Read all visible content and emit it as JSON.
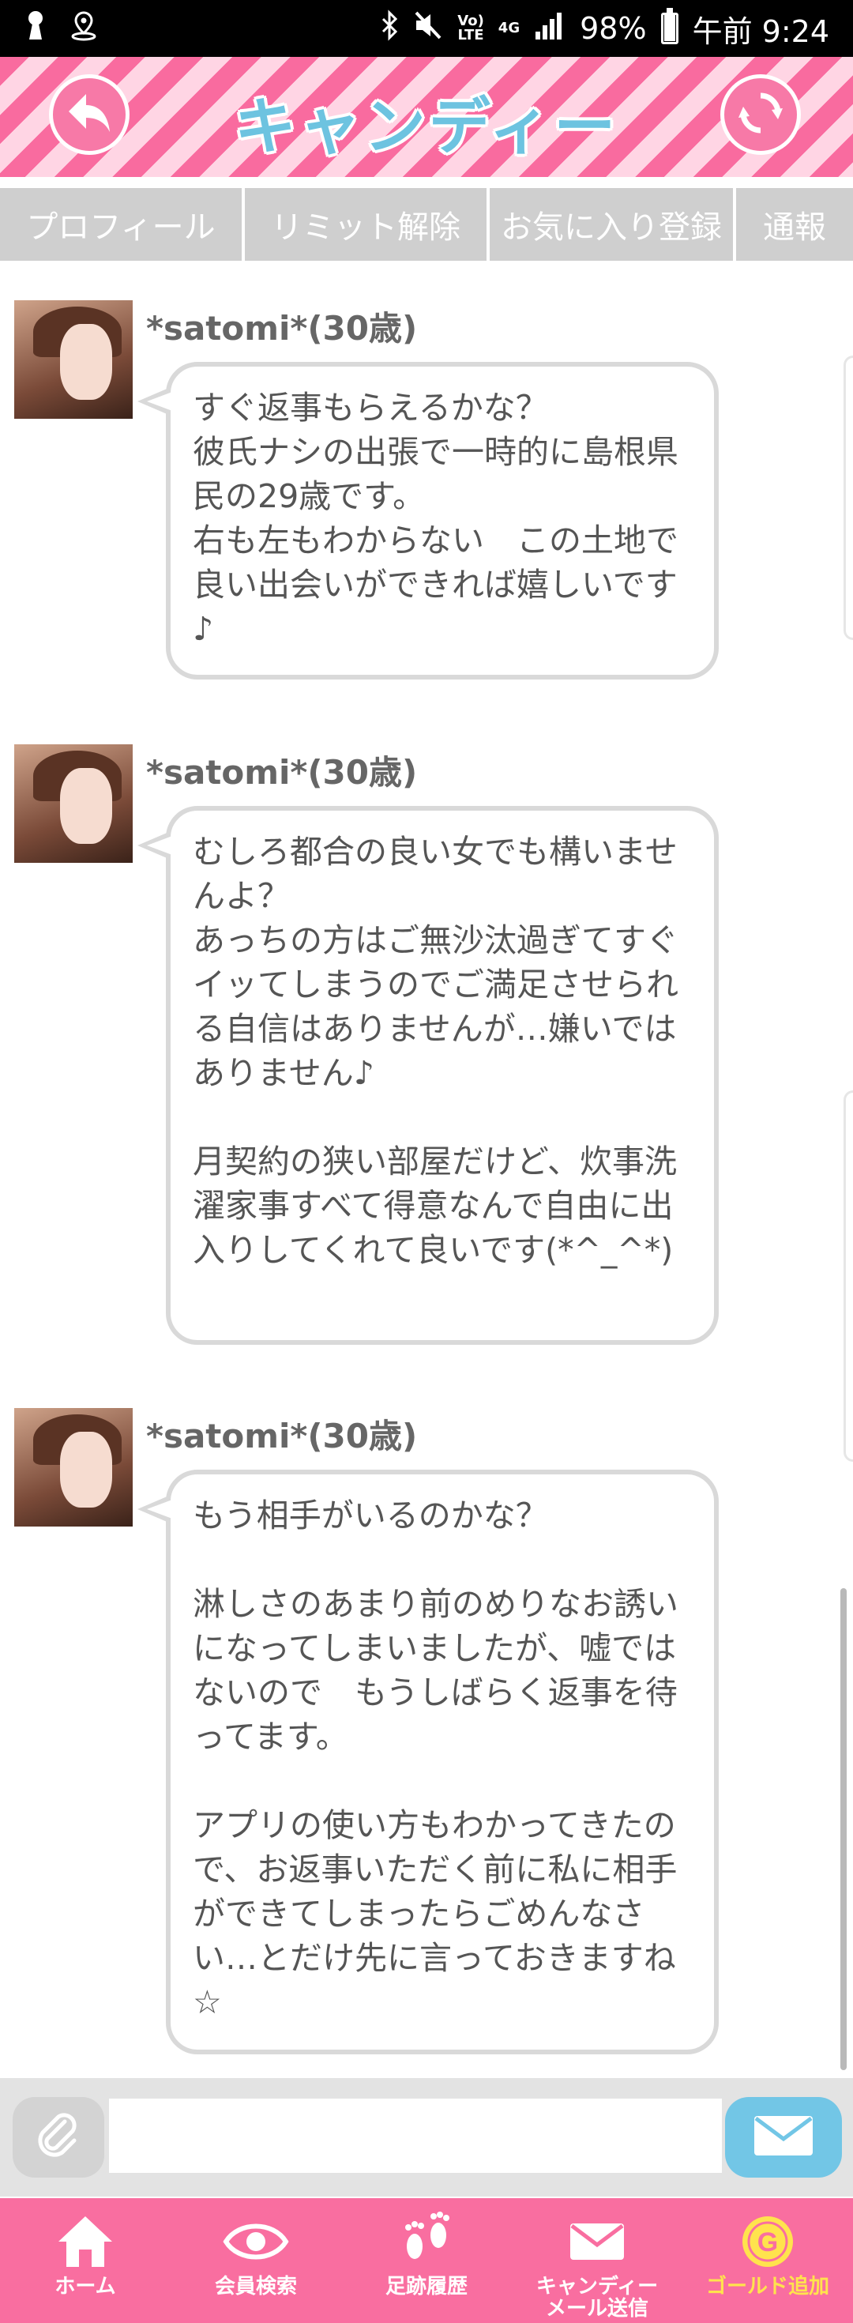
{
  "status_bar": {
    "battery": "98%",
    "time": "午前 9:24",
    "network_top": "Vo)",
    "network_bottom": "LTE",
    "signal_type": "4G",
    "battery_level": 0.98
  },
  "header": {
    "title": "キャンディー",
    "back_icon": "back-arrow-icon",
    "refresh_icon": "refresh-icon"
  },
  "tabs": [
    {
      "label": "プロフィール"
    },
    {
      "label": "リミット解除"
    },
    {
      "label": "お気に入り登録"
    },
    {
      "label": "通報"
    }
  ],
  "messages": [
    {
      "sender": "*satomi*(30歳)",
      "text": "すぐ返事もらえるかな？\n彼氏ナシの出張で一時的に島根県民の29歳です。\n右も左もわからない　この土地で良い出会いができれば嬉しいです♪"
    },
    {
      "sender": "*satomi*(30歳)",
      "text": "むしろ都合の良い女でも構いませんよ？\nあっちの方はご無沙汰過ぎてすぐイッてしまうのでご満足させられる自信はありませんが…嫌いではありません♪\n\n月契約の狭い部屋だけど、炊事洗濯家事すべて得意なんで自由に出入りしてくれて良いです(*^_^*)"
    },
    {
      "sender": "*satomi*(30歳)",
      "text": "もう相手がいるのかな？\n\n淋しさのあまり前のめりなお誘いになってしまいましたが、嘘ではないので　もうしばらく返事を待ってます。\n\nアプリの使い方もわかってきたので、お返事いただく前に私に相手ができてしまったらごめんなさい…とだけ先に言っておきますね☆"
    }
  ],
  "input": {
    "placeholder": ""
  },
  "bottom_nav": [
    {
      "label": "ホーム",
      "icon": "home-icon"
    },
    {
      "label": "会員検索",
      "icon": "eye-icon"
    },
    {
      "label": "足跡履歴",
      "icon": "footprint-icon"
    },
    {
      "label": "キャンディー\nメール送信",
      "icon": "mail-icon"
    },
    {
      "label": "ゴールド追加",
      "icon": "gold-coin-icon"
    }
  ],
  "colors": {
    "accent_pink": "#f96ea0",
    "title_blue": "#6dc3e0",
    "send_blue": "#72c6e6",
    "gold": "#ffe34d"
  }
}
